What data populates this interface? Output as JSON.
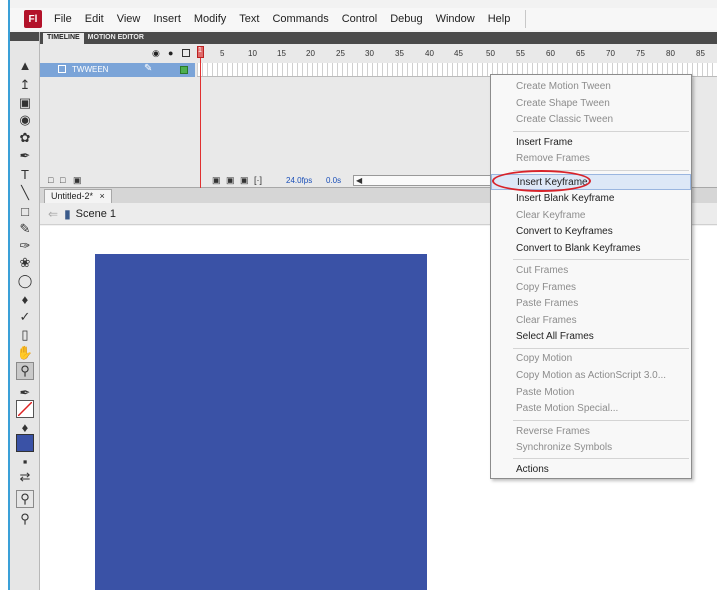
{
  "menubar": {
    "logo": "Fl",
    "items": [
      "File",
      "Edit",
      "View",
      "Insert",
      "Modify",
      "Text",
      "Commands",
      "Control",
      "Debug",
      "Window",
      "Help"
    ]
  },
  "timeline": {
    "tabs": [
      "TIMELINE",
      "MOTION EDITOR"
    ],
    "frame_numbers": [
      "1",
      "5",
      "10",
      "15",
      "20",
      "25",
      "30",
      "35",
      "40",
      "45",
      "50",
      "55",
      "60",
      "65",
      "70",
      "75",
      "80",
      "85"
    ],
    "layer_name": "TWWEEN",
    "current_frame": "1",
    "fps": "24.0fps",
    "elapsed": "0.0s"
  },
  "document": {
    "tab_label": "Untitled-2*",
    "scene_label": "Scene 1"
  },
  "context_menu": {
    "items": [
      {
        "label": "Create Motion Tween",
        "disabled": true
      },
      {
        "label": "Create Shape Tween",
        "disabled": true
      },
      {
        "label": "Create Classic Tween",
        "disabled": true
      },
      {
        "label": "Insert Frame",
        "disabled": false
      },
      {
        "label": "Remove Frames",
        "disabled": true
      },
      {
        "label": "Insert Keyframe",
        "disabled": false
      },
      {
        "label": "Insert Blank Keyframe",
        "disabled": false
      },
      {
        "label": "Clear Keyframe",
        "disabled": true
      },
      {
        "label": "Convert to Keyframes",
        "disabled": false
      },
      {
        "label": "Convert to Blank Keyframes",
        "disabled": false
      },
      {
        "label": "Cut Frames",
        "disabled": true
      },
      {
        "label": "Copy Frames",
        "disabled": true
      },
      {
        "label": "Paste Frames",
        "disabled": true
      },
      {
        "label": "Clear Frames",
        "disabled": true
      },
      {
        "label": "Select All Frames",
        "disabled": false
      },
      {
        "label": "Copy Motion",
        "disabled": true
      },
      {
        "label": "Copy Motion as ActionScript 3.0...",
        "disabled": true
      },
      {
        "label": "Paste Motion",
        "disabled": true
      },
      {
        "label": "Paste Motion Special...",
        "disabled": true
      },
      {
        "label": "Reverse Frames",
        "disabled": true
      },
      {
        "label": "Synchronize Symbols",
        "disabled": true
      },
      {
        "label": "Actions",
        "disabled": false
      }
    ]
  },
  "colors": {
    "stage_rect": "#3a52a6",
    "highlight_ring": "#d8232a",
    "layer_selected": "#7ba4d8"
  },
  "icons": [
    "selection-arrow-icon",
    "subselection-icon",
    "free-transform-icon",
    "3d-rotation-icon",
    "lasso-icon",
    "pen-icon",
    "text-icon",
    "line-icon",
    "rectangle-icon",
    "pencil-icon",
    "brush-icon",
    "deco-icon",
    "bone-icon",
    "paint-bucket-icon",
    "eyedropper-icon",
    "eraser-icon",
    "hand-icon",
    "zoom-icon",
    "stroke-color-icon",
    "fill-color-icon",
    "swap-colors-icon",
    "snap-icon"
  ]
}
